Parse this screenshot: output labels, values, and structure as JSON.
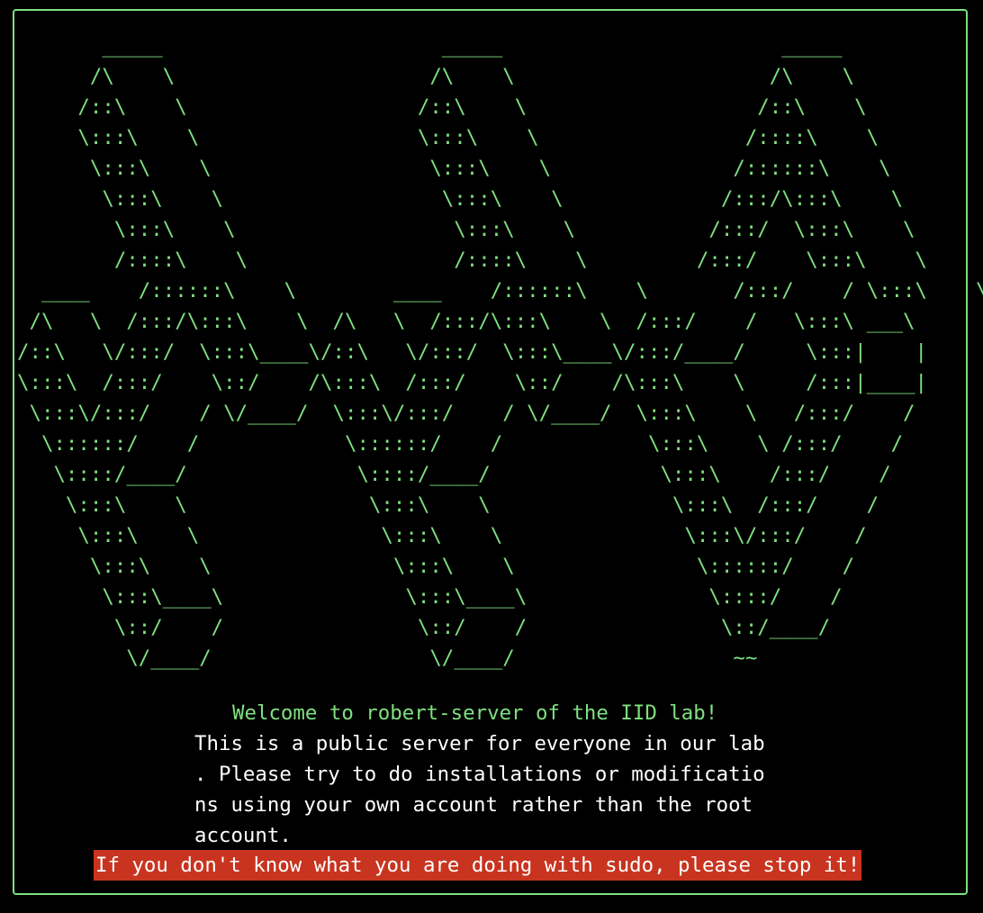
{
  "banner": {
    "ascii_art": "       _____                       _____                       _____\n      /\\    \\                     /\\    \\                     /\\    \\\n     /::\\    \\                   /::\\    \\                   /::\\    \\\n     \\:::\\    \\                  \\:::\\    \\                 /::::\\    \\\n      \\:::\\    \\                  \\:::\\    \\               /::::::\\    \\\n       \\:::\\    \\                  \\:::\\    \\             /:::/\\:::\\    \\\n        \\:::\\    \\                  \\:::\\    \\           /:::/  \\:::\\    \\\n        /::::\\    \\                 /::::\\    \\         /:::/    \\:::\\    \\\n  ____    /::::::\\    \\        ____    /::::::\\    \\       /:::/    / \\:::\\    \\\n /\\   \\  /:::/\\:::\\    \\  /\\   \\  /:::/\\:::\\    \\  /:::/    /   \\:::\\ ___\\\n/::\\   \\/:::/  \\:::\\____\\/::\\   \\/:::/  \\:::\\____\\/:::/____/     \\:::|    |\n\\:::\\  /:::/    \\::/    /\\:::\\  /:::/    \\::/    /\\:::\\    \\     /:::|____|\n \\:::\\/:::/    / \\/____/  \\:::\\/:::/    / \\/____/  \\:::\\    \\   /:::/    /\n  \\::::::/    /            \\::::::/    /            \\:::\\    \\ /:::/    /\n   \\::::/____/              \\::::/____/              \\:::\\    /:::/    /\n    \\:::\\    \\               \\:::\\    \\               \\:::\\  /:::/    /\n     \\:::\\    \\               \\:::\\    \\               \\:::\\/:::/    /\n      \\:::\\    \\               \\:::\\    \\               \\::::::/    /\n       \\:::\\____\\               \\:::\\____\\               \\::::/    /\n        \\::/    /                \\::/    /                \\::/____/\n         \\/____/                  \\/____/                  ~~",
    "welcome": "Welcome to robert-server of the IID lab!",
    "message_lines": [
      "This is a public server for everyone in our lab",
      ". Please try to do installations or modificatio",
      "ns using your own account rather than the root",
      "account."
    ],
    "warning": "If you don't know what you are doing with sudo, please stop it!"
  },
  "colors": {
    "background": "#000000",
    "accent_green": "#7fe07f",
    "text_white": "#ffffff",
    "warning_bg": "#c8341f"
  }
}
